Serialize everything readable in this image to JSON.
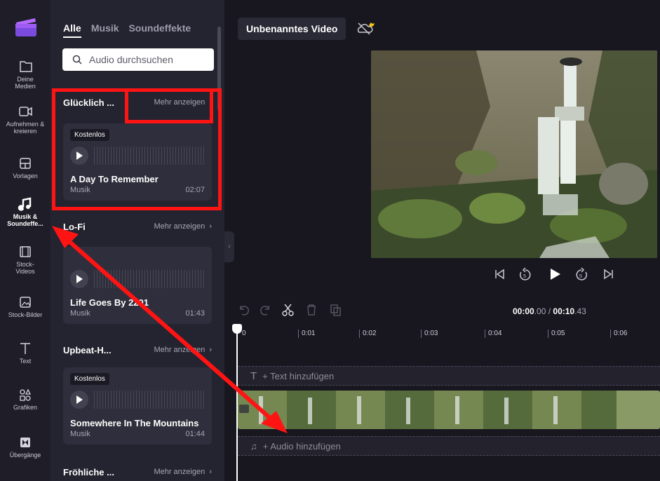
{
  "rail": {
    "items": [
      {
        "label": "Deine Medien",
        "icon": "folder-icon"
      },
      {
        "label": "Aufnehmen & kreieren",
        "icon": "camera-icon"
      },
      {
        "label": "Vorlagen",
        "icon": "templates-icon"
      },
      {
        "label": "Musik & Soundeffe...",
        "icon": "music-note-icon",
        "active": true
      },
      {
        "label": "Stock-Videos",
        "icon": "film-icon"
      },
      {
        "label": "Stock-Bilder",
        "icon": "image-icon"
      },
      {
        "label": "Text",
        "icon": "text-icon"
      },
      {
        "label": "Grafiken",
        "icon": "shapes-icon"
      },
      {
        "label": "Übergänge",
        "icon": "transition-icon"
      }
    ]
  },
  "library": {
    "tabs": [
      "Alle",
      "Musik",
      "Soundeffekte"
    ],
    "active_tab": "Alle",
    "search_placeholder": "Audio durchsuchen",
    "sections": [
      {
        "title": "Glücklich ...",
        "more": "Mehr anzeigen",
        "card": {
          "badge": "Kostenlos",
          "title": "A Day To Remember",
          "genre": "Musik",
          "duration": "02:07"
        }
      },
      {
        "title": "Lo-Fi",
        "more": "Mehr anzeigen",
        "card": {
          "badge": "",
          "title": "Life Goes By 2201",
          "genre": "Musik",
          "duration": "01:43"
        }
      },
      {
        "title": "Upbeat-H...",
        "more": "Mehr anzeigen",
        "card": {
          "badge": "Kostenlos",
          "title": "Somewhere In The Mountains",
          "genre": "Musik",
          "duration": "01:44"
        }
      },
      {
        "title": "Fröhliche ...",
        "more": "Mehr anzeigen"
      }
    ]
  },
  "editor": {
    "project_title": "Unbenanntes Video",
    "timecode_current_main": "00:00",
    "timecode_current_frac": ".00",
    "timecode_sep": " / ",
    "timecode_total_main": "00:10",
    "timecode_total_frac": ".43",
    "ruler_ticks": [
      "0",
      "0:01",
      "0:02",
      "0:03",
      "0:04",
      "0:05",
      "0:06"
    ],
    "text_track_label": "+ Text hinzufügen",
    "audio_track_label": "+ Audio hinzufügen"
  },
  "colors": {
    "annotation": "#ff1414",
    "panel_bg": "#242330",
    "card_bg": "#2f2e3c"
  }
}
